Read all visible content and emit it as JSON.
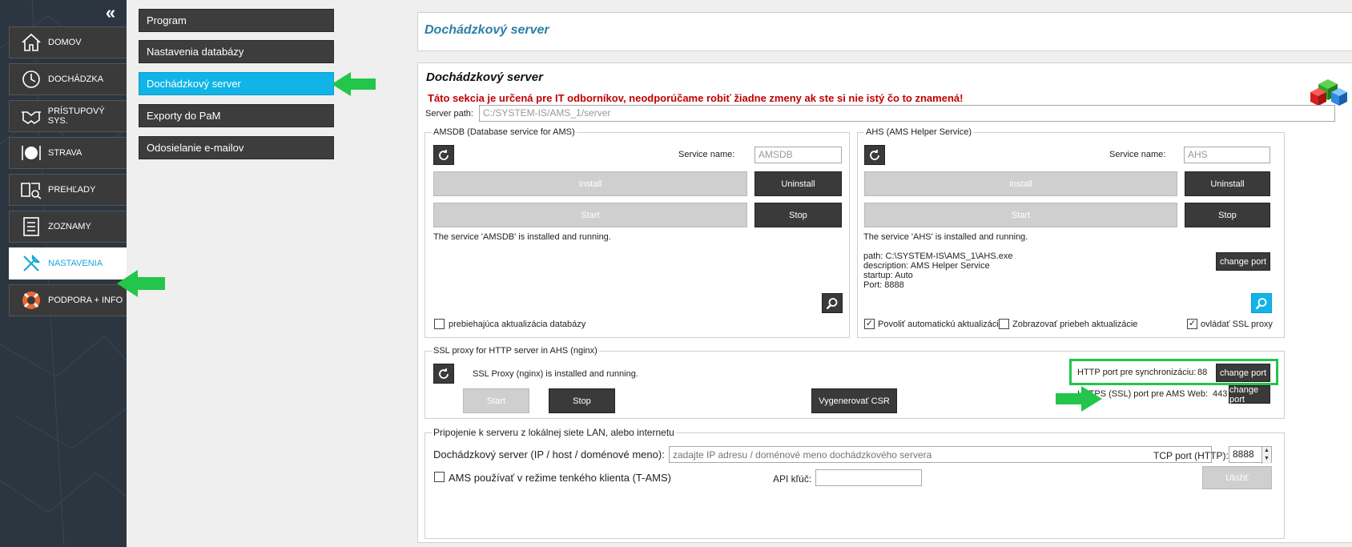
{
  "sidebar": {
    "collapse_glyph": "«",
    "items": [
      {
        "label": "DOMOV",
        "icon": "home-icon"
      },
      {
        "label": "DOCHÁDZKA",
        "icon": "clock-icon"
      },
      {
        "label": "PRÍSTUPOVÝ SYS.",
        "icon": "handshake-icon"
      },
      {
        "label": "STRAVA",
        "icon": "plate-icon"
      },
      {
        "label": "PREHĽADY",
        "icon": "book-search-icon"
      },
      {
        "label": "ZOZNAMY",
        "icon": "list-icon"
      },
      {
        "label": "NASTAVENIA",
        "icon": "tools-icon",
        "active": true
      },
      {
        "label": "PODPORA + INFO",
        "icon": "lifebuoy-icon"
      }
    ]
  },
  "settings_menu": {
    "items": [
      {
        "label": "Program"
      },
      {
        "label": "Nastavenia databázy"
      },
      {
        "label": "Dochádzkový server",
        "active": true
      },
      {
        "label": "Exporty do PaM"
      },
      {
        "label": "Odosielanie e-mailov"
      }
    ]
  },
  "header": {
    "title": "Dochádzkový server"
  },
  "main": {
    "section_title": "Dochádzkový server",
    "warning": "Táto sekcia je určená pre IT odborníkov, neodporúčame robiť žiadne zmeny ak ste si nie istý čo to znamená!",
    "server_path_label": "Server path:",
    "server_path_value": "C:/SYSTEM-IS/AMS_1/server",
    "amsdb": {
      "legend": "AMSDB (Database service for AMS)",
      "service_name_label": "Service name:",
      "service_name_value": "AMSDB",
      "install_label": "Install",
      "uninstall_label": "Uninstall",
      "start_label": "Start",
      "stop_label": "Stop",
      "status": "The service 'AMSDB' is installed and running.",
      "checkbox_label": "prebiehajúca aktualizácia databázy"
    },
    "ahs": {
      "legend": "AHS (AMS Helper Service)",
      "service_name_label": "Service name:",
      "service_name_value": "AHS",
      "install_label": "Install",
      "uninstall_label": "Uninstall",
      "start_label": "Start",
      "stop_label": "Stop",
      "status": "The service 'AHS' is installed and running.",
      "path_line": "path: C:\\SYSTEM-IS\\AMS_1\\AHS.exe",
      "description_line": "description: AMS Helper Service",
      "startup_line": "startup: Auto",
      "port_line": "Port: 8888",
      "change_port_label": "change port",
      "check_auto_update": "Povoliť automatickú aktualizáciu",
      "check_show_progress": "Zobrazovať priebeh aktualizácie",
      "check_ssl_proxy": "ovládať SSL proxy",
      "check_mark": "✓"
    },
    "ssl": {
      "legend": "SSL proxy for HTTP server in AHS (nginx)",
      "status": "SSL Proxy (nginx) is installed and running.",
      "start_label": "Start",
      "stop_label": "Stop",
      "csr_label": "Vygenerovať CSR",
      "http_port_label": "HTTP port pre synchronizáciu:",
      "http_port_value": "88",
      "https_port_label": "HTTPS (SSL) port pre AMS Web:",
      "https_port_value": "443",
      "change_port_label": "change port"
    },
    "connection": {
      "legend": "Pripojenie k serveru z lokálnej siete LAN, alebo internetu",
      "server_label": "Dochádzkový server (IP / host / doménové meno):",
      "server_placeholder": "zadajte IP adresu / doménové meno dochádzkového servera",
      "tcp_port_label": "TCP port (HTTP):",
      "tcp_port_value": "8888",
      "thin_client_label": "AMS používať v režime tenkého klienta (T-AMS)",
      "api_key_label": "API kľúč:",
      "api_key_value": "",
      "save_label": "Uložiť"
    }
  },
  "colors": {
    "accent": "#11b4e6",
    "sidebar_bg": "#2c3640",
    "dark_button": "#3a3a3a",
    "warning": "#c00000",
    "arrow_green": "#23c64a",
    "title_blue": "#2b7fa6"
  }
}
